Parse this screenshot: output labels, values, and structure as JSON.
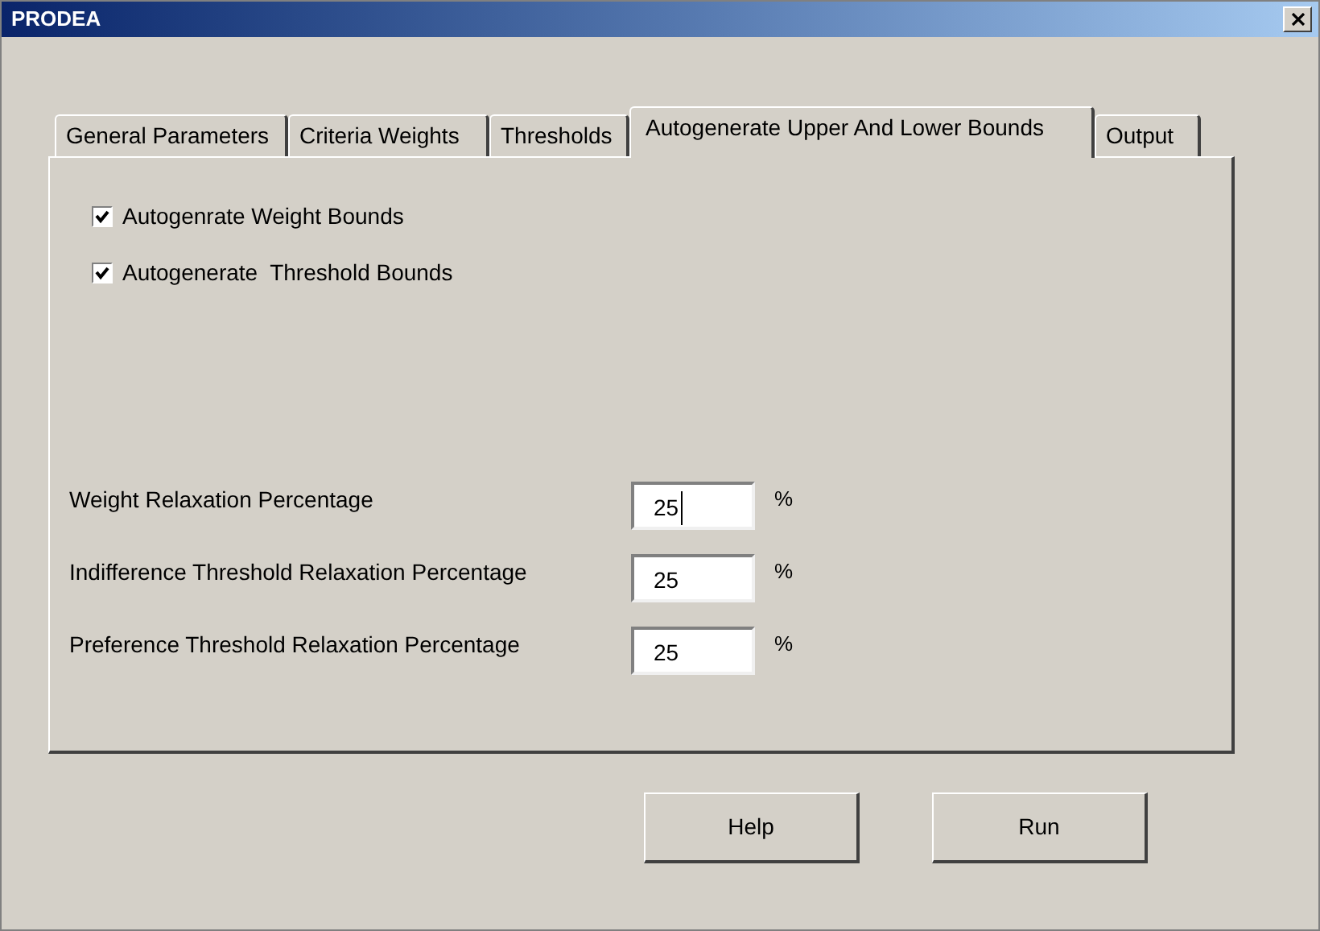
{
  "window": {
    "title": "PRODEA"
  },
  "tabs": [
    {
      "label": "General Parameters",
      "selected": false
    },
    {
      "label": "Criteria Weights",
      "selected": false
    },
    {
      "label": "Thresholds",
      "selected": false
    },
    {
      "label": "Autogenerate Upper And Lower Bounds",
      "selected": true
    },
    {
      "label": "Output",
      "selected": false
    }
  ],
  "checkboxes": [
    {
      "label": "Autogenrate Weight Bounds",
      "checked": true
    },
    {
      "label": "Autogenerate  Threshold Bounds",
      "checked": true
    }
  ],
  "fields": [
    {
      "label": "Weight Relaxation Percentage",
      "value": "25",
      "unit": "%",
      "focused": true
    },
    {
      "label": "Indifference Threshold Relaxation Percentage",
      "value": "25",
      "unit": "%",
      "focused": false
    },
    {
      "label": "Preference Threshold Relaxation Percentage",
      "value": "25",
      "unit": "%",
      "focused": false
    }
  ],
  "buttons": [
    "Help",
    "Run"
  ]
}
